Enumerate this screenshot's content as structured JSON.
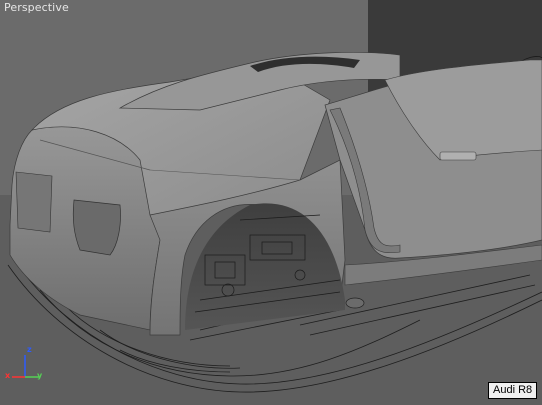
{
  "viewport": {
    "label": "Perspective"
  },
  "axis_gizmo": {
    "z": "z",
    "x": "x",
    "y": "y",
    "colors": {
      "x": "#ff3333",
      "y": "#55d055",
      "z": "#2d5bff"
    }
  },
  "object_tooltip": {
    "text": "Audi R8"
  },
  "colors": {
    "background_panel": "#3a3a3a",
    "ground": "#5a5a5a",
    "body": "#8a8a8a"
  }
}
